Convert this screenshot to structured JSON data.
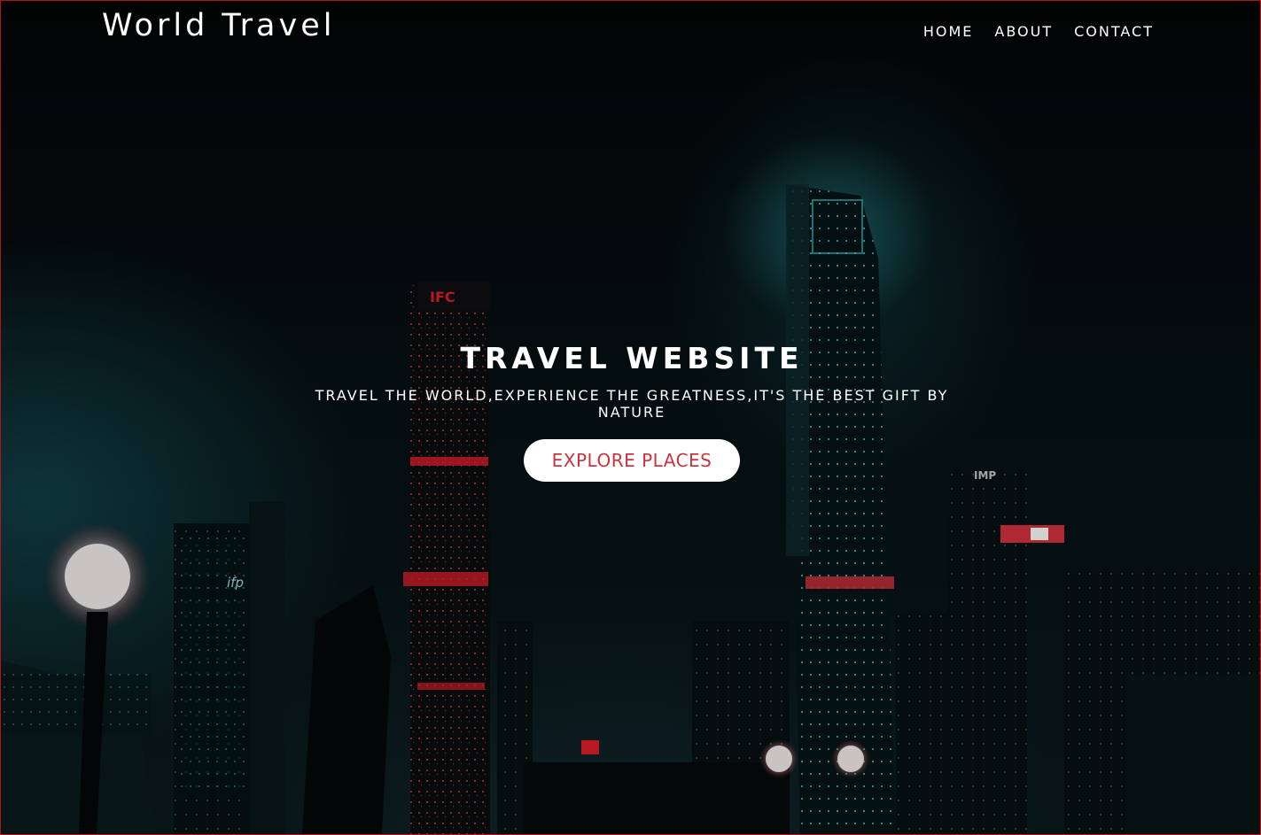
{
  "header": {
    "brand": "World Travel",
    "nav": [
      "HOME",
      "ABOUT",
      "CONTACT"
    ]
  },
  "hero": {
    "title": "TRAVEL WEBSITE",
    "subtitle": "TRAVEL THE WORLD,EXPERIENCE THE GREATNESS,IT'S THE BEST GIFT BY NATURE",
    "cta_label": "EXPLORE PLACES"
  },
  "background": {
    "description_icon": "night-city-skyline-image",
    "signs": [
      "IFC",
      "ifp",
      "IMP"
    ]
  },
  "colors": {
    "accent": "#cc3340",
    "frame_border": "#b3141c",
    "neon_teal": "#2fc9d4",
    "neon_red": "#e0202a"
  }
}
